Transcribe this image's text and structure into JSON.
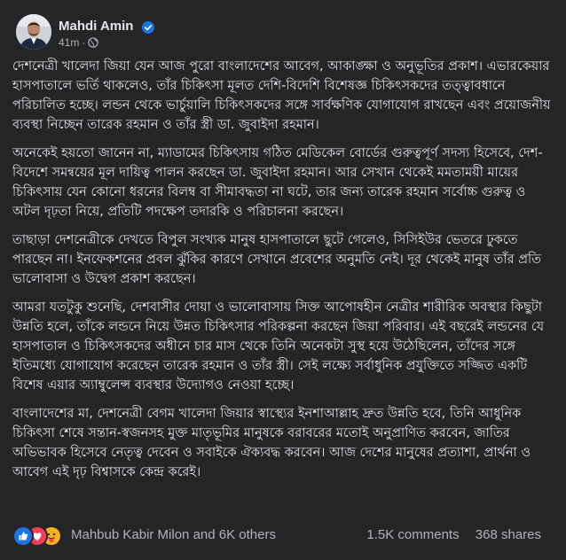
{
  "post": {
    "author": "Mahdi Amin",
    "time": "41m",
    "separator": "·",
    "icons": {
      "verified": "verified-badge-icon",
      "audience": "globe-icon"
    },
    "paragraphs": [
      "দেশনেত্রী খালেদা জিয়া যেন আজ পুরো বাংলাদেশের আবেগ, আকাঙ্ক্ষা ও অনুভূতির প্রকাশ। এভারকেয়ার হাসপাতালে ভর্তি থাকলেও, তাঁর চিকিৎসা মূলত দেশি-বিদেশি বিশেষজ্ঞ চিকিৎসকদের তত্ত্বাবধানে পরিচালিত হচ্ছে। লন্ডন থেকে ভার্চুয়ালি চিকিৎসকদের সঙ্গে সার্বক্ষণিক যোগাযোগ রাখছেন এবং প্রয়োজনীয় ব্যবস্থা নিচ্ছেন তারেক রহমান ও তাঁর স্ত্রী ডা. জুবাইদা রহমান।",
      "অনেকেই হয়তো জানেন না, ম্যাডামের চিকিৎসায় গঠিত মেডিকেল বোর্ডের গুরুত্বপূর্ণ সদস্য হিসেবে, দেশ-বিদেশে সমন্বয়ের মূল দায়িত্ব পালন করছেন ডা. জুবাইদা রহমান। আর সেখান থেকেই মমতাময়ী মায়ের চিকিৎসায় যেন কোনো ধরনের বিলম্ব বা সীমাবদ্ধতা না ঘটে, তার জন্য তারেক রহমান সর্বোচ্চ গুরুত্ব ও অটল দৃঢ়তা নিয়ে, প্রতিটি পদক্ষেপ তদারকি ও পরিচালনা করছেন।",
      "তাছাড়া দেশনেত্রীকে দেখতে বিপুল সংখ্যক মানুষ হাসপাতালে ছুটে গেলেও, সিসিইউর ভেতরে ঢুকতে পারছেন না। ইনফেকশনের প্রবল ঝুঁকির কারণে সেখানে প্রবেশের অনুমতি নেই। দূর থেকেই মানুষ তাঁর প্রতি ভালোবাসা ও উদ্বেগ প্রকাশ করছেন।",
      "আমরা যতটুকু শুনেছি, দেশবাসীর দোয়া ও ভালোবাসায় সিক্ত আপোষহীন নেত্রীর শারীরিক অবস্থার কিছুটা উন্নতি হলে, তাঁকে লন্ডনে নিয়ে উন্নত চিকিৎসার পরিকল্পনা করছেন জিয়া পরিবার। এই বছরেই লন্ডনের যে হাসপাতাল ও চিকিৎসকদের অধীনে চার মাস থেকে তিনি অনেকটা সুস্থ হয়ে উঠেছিলেন, তাঁদের সঙ্গে ইতিমধ্যে যোগাযোগ করেছেন তারেক রহমান ও তাঁর স্ত্রী। সেই লক্ষ্যে সর্বাধুনিক প্রযুক্তিতে সজ্জিত একটি বিশেষ এয়ার অ্যাম্বুলেন্স ব্যবস্থার উদ্যোগও নেওয়া হচ্ছে।",
      "বাংলাদেশের মা, দেশনেত্রী বেগম খালেদা জিয়ার স্বাস্থ্যের ইনশাআল্লাহ দ্রুত উন্নতি হবে, তিনি আধুনিক চিকিৎসা শেষে সন্তান-স্বজনসহ মুক্ত মাতৃভূমির মানুষকে বরাবরের মতোই অনুপ্রাণিত করবেন, জাতির অভিভাবক হিসেবে নেতৃত্ব দেবেন ও সবাইকে ঐক্যবদ্ধ করবেন। আজ দেশের মানুষের প্রত্যাশা, প্রার্থনা ও আবেগ এই দৃঢ় বিশ্বাসকে কেন্দ্র করেই।"
    ],
    "reactions": {
      "icons": [
        "like-reaction-icon",
        "love-reaction-icon",
        "care-reaction-icon"
      ],
      "summary": "Mahbub Kabir Milon and 6K others",
      "comments": "1.5K comments",
      "shares": "368 shares"
    },
    "colors": {
      "background": "#242526",
      "text": "#e4e6eb",
      "secondary": "#b0b3b8",
      "verified": "#1b74e4"
    }
  }
}
